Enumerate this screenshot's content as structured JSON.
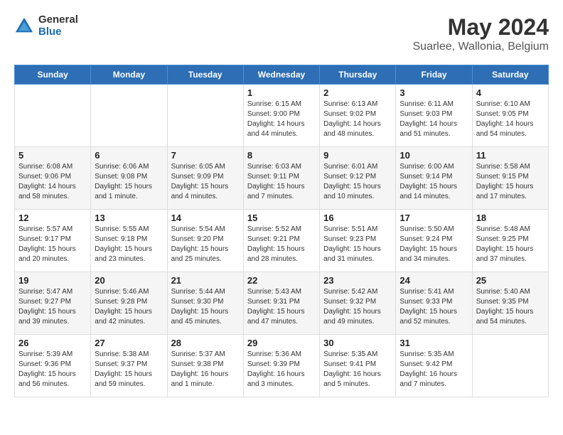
{
  "header": {
    "logo_general": "General",
    "logo_blue": "Blue",
    "month": "May 2024",
    "location": "Suarlee, Wallonia, Belgium"
  },
  "weekdays": [
    "Sunday",
    "Monday",
    "Tuesday",
    "Wednesday",
    "Thursday",
    "Friday",
    "Saturday"
  ],
  "weeks": [
    {
      "days": [
        {
          "num": "",
          "info": ""
        },
        {
          "num": "",
          "info": ""
        },
        {
          "num": "",
          "info": ""
        },
        {
          "num": "1",
          "info": "Sunrise: 6:15 AM\nSunset: 9:00 PM\nDaylight: 14 hours\nand 44 minutes."
        },
        {
          "num": "2",
          "info": "Sunrise: 6:13 AM\nSunset: 9:02 PM\nDaylight: 14 hours\nand 48 minutes."
        },
        {
          "num": "3",
          "info": "Sunrise: 6:11 AM\nSunset: 9:03 PM\nDaylight: 14 hours\nand 51 minutes."
        },
        {
          "num": "4",
          "info": "Sunrise: 6:10 AM\nSunset: 9:05 PM\nDaylight: 14 hours\nand 54 minutes."
        }
      ]
    },
    {
      "days": [
        {
          "num": "5",
          "info": "Sunrise: 6:08 AM\nSunset: 9:06 PM\nDaylight: 14 hours\nand 58 minutes."
        },
        {
          "num": "6",
          "info": "Sunrise: 6:06 AM\nSunset: 9:08 PM\nDaylight: 15 hours\nand 1 minute."
        },
        {
          "num": "7",
          "info": "Sunrise: 6:05 AM\nSunset: 9:09 PM\nDaylight: 15 hours\nand 4 minutes."
        },
        {
          "num": "8",
          "info": "Sunrise: 6:03 AM\nSunset: 9:11 PM\nDaylight: 15 hours\nand 7 minutes."
        },
        {
          "num": "9",
          "info": "Sunrise: 6:01 AM\nSunset: 9:12 PM\nDaylight: 15 hours\nand 10 minutes."
        },
        {
          "num": "10",
          "info": "Sunrise: 6:00 AM\nSunset: 9:14 PM\nDaylight: 15 hours\nand 14 minutes."
        },
        {
          "num": "11",
          "info": "Sunrise: 5:58 AM\nSunset: 9:15 PM\nDaylight: 15 hours\nand 17 minutes."
        }
      ]
    },
    {
      "days": [
        {
          "num": "12",
          "info": "Sunrise: 5:57 AM\nSunset: 9:17 PM\nDaylight: 15 hours\nand 20 minutes."
        },
        {
          "num": "13",
          "info": "Sunrise: 5:55 AM\nSunset: 9:18 PM\nDaylight: 15 hours\nand 23 minutes."
        },
        {
          "num": "14",
          "info": "Sunrise: 5:54 AM\nSunset: 9:20 PM\nDaylight: 15 hours\nand 25 minutes."
        },
        {
          "num": "15",
          "info": "Sunrise: 5:52 AM\nSunset: 9:21 PM\nDaylight: 15 hours\nand 28 minutes."
        },
        {
          "num": "16",
          "info": "Sunrise: 5:51 AM\nSunset: 9:23 PM\nDaylight: 15 hours\nand 31 minutes."
        },
        {
          "num": "17",
          "info": "Sunrise: 5:50 AM\nSunset: 9:24 PM\nDaylight: 15 hours\nand 34 minutes."
        },
        {
          "num": "18",
          "info": "Sunrise: 5:48 AM\nSunset: 9:25 PM\nDaylight: 15 hours\nand 37 minutes."
        }
      ]
    },
    {
      "days": [
        {
          "num": "19",
          "info": "Sunrise: 5:47 AM\nSunset: 9:27 PM\nDaylight: 15 hours\nand 39 minutes."
        },
        {
          "num": "20",
          "info": "Sunrise: 5:46 AM\nSunset: 9:28 PM\nDaylight: 15 hours\nand 42 minutes."
        },
        {
          "num": "21",
          "info": "Sunrise: 5:44 AM\nSunset: 9:30 PM\nDaylight: 15 hours\nand 45 minutes."
        },
        {
          "num": "22",
          "info": "Sunrise: 5:43 AM\nSunset: 9:31 PM\nDaylight: 15 hours\nand 47 minutes."
        },
        {
          "num": "23",
          "info": "Sunrise: 5:42 AM\nSunset: 9:32 PM\nDaylight: 15 hours\nand 49 minutes."
        },
        {
          "num": "24",
          "info": "Sunrise: 5:41 AM\nSunset: 9:33 PM\nDaylight: 15 hours\nand 52 minutes."
        },
        {
          "num": "25",
          "info": "Sunrise: 5:40 AM\nSunset: 9:35 PM\nDaylight: 15 hours\nand 54 minutes."
        }
      ]
    },
    {
      "days": [
        {
          "num": "26",
          "info": "Sunrise: 5:39 AM\nSunset: 9:36 PM\nDaylight: 15 hours\nand 56 minutes."
        },
        {
          "num": "27",
          "info": "Sunrise: 5:38 AM\nSunset: 9:37 PM\nDaylight: 15 hours\nand 59 minutes."
        },
        {
          "num": "28",
          "info": "Sunrise: 5:37 AM\nSunset: 9:38 PM\nDaylight: 16 hours\nand 1 minute."
        },
        {
          "num": "29",
          "info": "Sunrise: 5:36 AM\nSunset: 9:39 PM\nDaylight: 16 hours\nand 3 minutes."
        },
        {
          "num": "30",
          "info": "Sunrise: 5:35 AM\nSunset: 9:41 PM\nDaylight: 16 hours\nand 5 minutes."
        },
        {
          "num": "31",
          "info": "Sunrise: 5:35 AM\nSunset: 9:42 PM\nDaylight: 16 hours\nand 7 minutes."
        },
        {
          "num": "",
          "info": ""
        }
      ]
    }
  ]
}
